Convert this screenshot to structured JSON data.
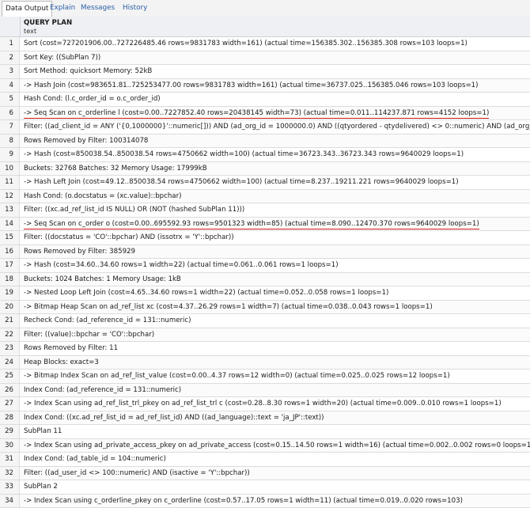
{
  "tabs": [
    {
      "label": "Data Output",
      "active": true
    },
    {
      "label": "Explain",
      "active": false
    },
    {
      "label": "Messages",
      "active": false
    },
    {
      "label": "History",
      "active": false
    }
  ],
  "header": {
    "column_name": "QUERY PLAN",
    "column_type": "text"
  },
  "highlight_color": "#d31b1b",
  "rows": [
    {
      "n": "1",
      "text": "Sort (cost=727201906.00..727226485.46 rows=9831783 width=161) (actual time=156385.302..156385.308 rows=103 loops=1)"
    },
    {
      "n": "2",
      "text": "Sort Key: ((SubPlan 7))"
    },
    {
      "n": "3",
      "text": "Sort Method: quicksort Memory: 52kB"
    },
    {
      "n": "4",
      "text": "-> Hash Join (cost=983651.81..725253477.00 rows=9831783 width=161) (actual time=36737.025..156385.046 rows=103 loops=1)"
    },
    {
      "n": "5",
      "text": "Hash Cond: (l.c_order_id = o.c_order_id)"
    },
    {
      "n": "6",
      "text": "-> Seq Scan on c_orderline l (cost=0.00..7227852.40 rows=20438145 width=73) (actual time=0.011..114237.871 rows=4152 loops=1)",
      "highlighted": true
    },
    {
      "n": "7",
      "text": "Filter: ((ad_client_id = ANY ('{0,1000000}'::numeric[])) AND (ad_org_id = 1000000.0) AND ((qtyordered - qtydelivered) <> 0::numeric) AND (ad_org_id ="
    },
    {
      "n": "8",
      "text": "Rows Removed by Filter: 100314078"
    },
    {
      "n": "9",
      "text": "-> Hash (cost=850038.54..850038.54 rows=4750662 width=100) (actual time=36723.343..36723.343 rows=9640029 loops=1)"
    },
    {
      "n": "10",
      "text": "Buckets: 32768 Batches: 32 Memory Usage: 17999kB"
    },
    {
      "n": "11",
      "text": "-> Hash Left Join (cost=49.12..850038.54 rows=4750662 width=100) (actual time=8.237..19211.221 rows=9640029 loops=1)"
    },
    {
      "n": "12",
      "text": "Hash Cond: (o.docstatus = (xc.value)::bpchar)"
    },
    {
      "n": "13",
      "text": "Filter: ((xc.ad_ref_list_id IS NULL) OR (NOT (hashed SubPlan 11)))"
    },
    {
      "n": "14",
      "text": "-> Seq Scan on c_order o (cost=0.00..695592.93 rows=9501323 width=85) (actual time=8.090..12470.370 rows=9640029 loops=1)",
      "highlighted": true
    },
    {
      "n": "15",
      "text": "Filter: ((docstatus = 'CO'::bpchar) AND (issotrx = 'Y'::bpchar))"
    },
    {
      "n": "16",
      "text": "Rows Removed by Filter: 385929"
    },
    {
      "n": "17",
      "text": "-> Hash (cost=34.60..34.60 rows=1 width=22) (actual time=0.061..0.061 rows=1 loops=1)"
    },
    {
      "n": "18",
      "text": "Buckets: 1024 Batches: 1 Memory Usage: 1kB"
    },
    {
      "n": "19",
      "text": "-> Nested Loop Left Join (cost=4.65..34.60 rows=1 width=22) (actual time=0.052..0.058 rows=1 loops=1)"
    },
    {
      "n": "20",
      "text": "-> Bitmap Heap Scan on ad_ref_list xc (cost=4.37..26.29 rows=1 width=7) (actual time=0.038..0.043 rows=1 loops=1)"
    },
    {
      "n": "21",
      "text": "Recheck Cond: (ad_reference_id = 131::numeric)"
    },
    {
      "n": "22",
      "text": "Filter: ((value)::bpchar = 'CO'::bpchar)"
    },
    {
      "n": "23",
      "text": "Rows Removed by Filter: 11"
    },
    {
      "n": "24",
      "text": "Heap Blocks: exact=3"
    },
    {
      "n": "25",
      "text": "-> Bitmap Index Scan on ad_ref_list_value (cost=0.00..4.37 rows=12 width=0) (actual time=0.025..0.025 rows=12 loops=1)"
    },
    {
      "n": "26",
      "text": "Index Cond: (ad_reference_id = 131::numeric)"
    },
    {
      "n": "27",
      "text": "-> Index Scan using ad_ref_list_trl_pkey on ad_ref_list_trl c (cost=0.28..8.30 rows=1 width=20) (actual time=0.009..0.010 rows=1 loops=1)"
    },
    {
      "n": "28",
      "text": "Index Cond: ((xc.ad_ref_list_id = ad_ref_list_id) AND ((ad_language)::text = 'ja_JP'::text))"
    },
    {
      "n": "29",
      "text": "SubPlan 11"
    },
    {
      "n": "30",
      "text": "-> Index Scan using ad_private_access_pkey on ad_private_access (cost=0.15..14.50 rows=1 width=16) (actual time=0.002..0.002 rows=0 loops=1)"
    },
    {
      "n": "31",
      "text": "Index Cond: (ad_table_id = 104::numeric)"
    },
    {
      "n": "32",
      "text": "Filter: ((ad_user_id <> 100::numeric) AND (isactive = 'Y'::bpchar))"
    },
    {
      "n": "33",
      "text": "SubPlan 2"
    },
    {
      "n": "34",
      "text": "-> Index Scan using c_orderline_pkey on c_orderline (cost=0.57..17.05 rows=1 width=11) (actual time=0.019..0.020 rows=103)"
    }
  ]
}
